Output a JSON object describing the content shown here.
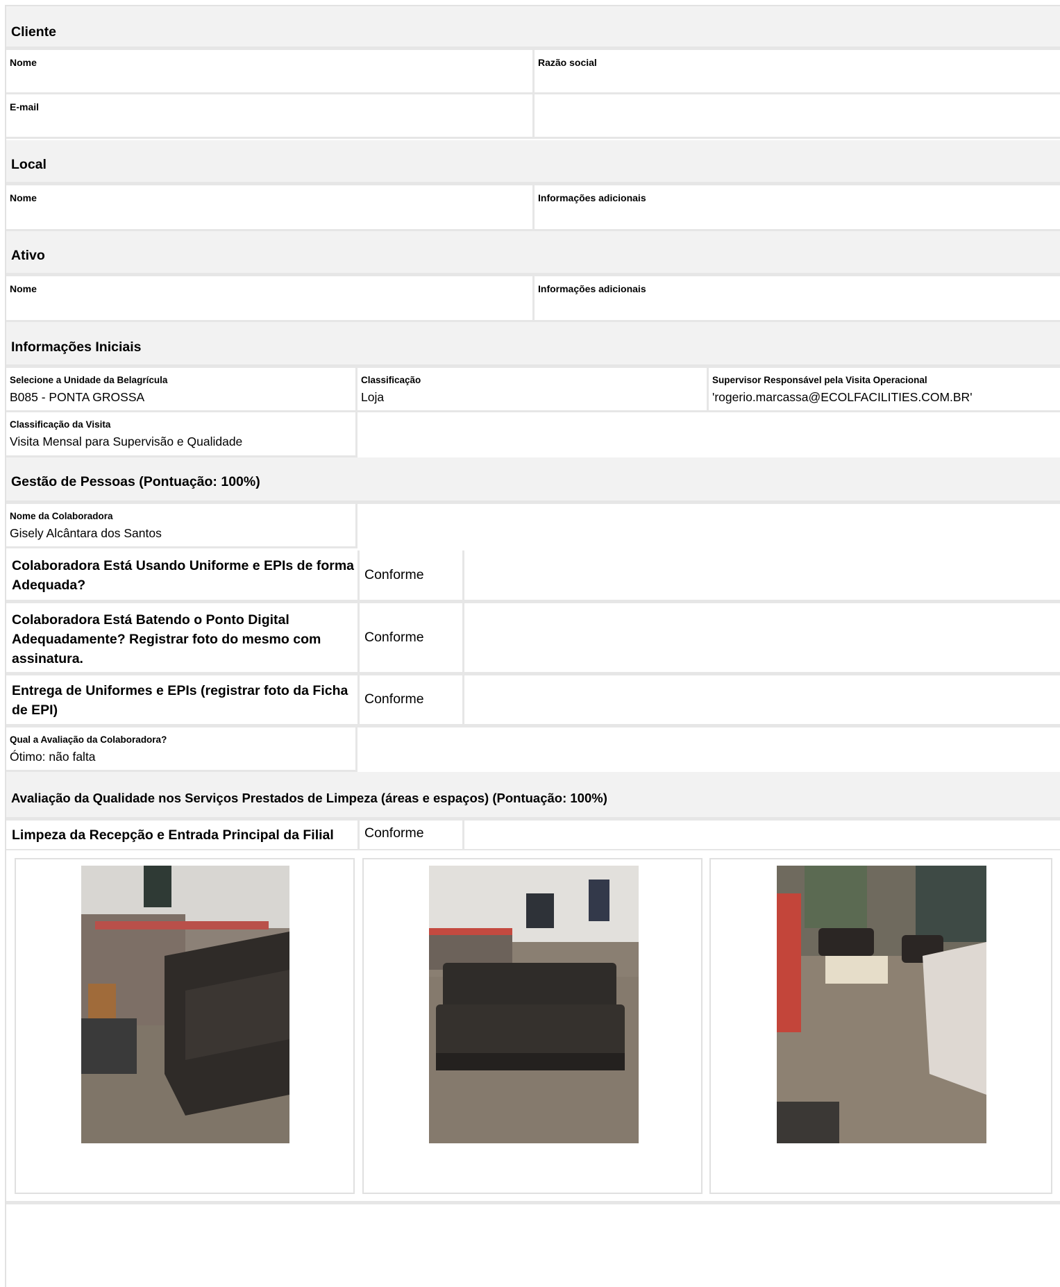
{
  "cliente": {
    "title": "Cliente",
    "nome_label": "Nome",
    "razao_label": "Razão social",
    "email_label": "E-mail"
  },
  "local": {
    "title": "Local",
    "nome_label": "Nome",
    "info_label": "Informações adicionais"
  },
  "ativo": {
    "title": "Ativo",
    "nome_label": "Nome",
    "info_label": "Informações adicionais"
  },
  "iniciais": {
    "title": "Informações Iniciais",
    "unidade_label": "Selecione a Unidade da Belagrícula",
    "unidade_value": "B085 - PONTA GROSSA",
    "classificacao_label": "Classificação",
    "classificacao_value": "Loja",
    "supervisor_label": "Supervisor Responsável pela Visita Operacional",
    "supervisor_value": "'rogerio.marcassa@ECOLFACILITIES.COM.BR'",
    "visita_label": "Classificação da Visita",
    "visita_value": "Visita Mensal para Supervisão e Qualidade"
  },
  "pessoas": {
    "title": "Gestão de Pessoas (Pontuação: 100%)",
    "colab_label": "Nome da Colaboradora",
    "colab_value": "Gisely Alcântara dos Santos",
    "q1": "Colaboradora Está Usando Uniforme e EPIs de forma Adequada?",
    "a1": "Conforme",
    "q2": "Colaboradora Está Batendo o Ponto Digital Adequadamente? Registrar foto do mesmo com assinatura.",
    "a2": "Conforme",
    "q3": "Entrega de Uniformes e EPIs (registrar foto da Ficha de EPI)",
    "a3": "Conforme",
    "aval_label": "Qual a Avaliação da Colaboradora?",
    "aval_value": "Ótimo: não falta"
  },
  "limpeza": {
    "title": "Avaliação da Qualidade nos Serviços Prestados de Limpeza (áreas e espaços) (Pontuação: 100%)",
    "q1": "Limpeza da Recepção e Entrada Principal da Filial",
    "a1": "Conforme",
    "photos": [
      "reception-sofa-photo",
      "reception-sofa-front-photo",
      "entrance-hall-photo"
    ]
  },
  "colors": {
    "section_bg": "#f2f2f2",
    "divider": "#e6e6e6"
  }
}
